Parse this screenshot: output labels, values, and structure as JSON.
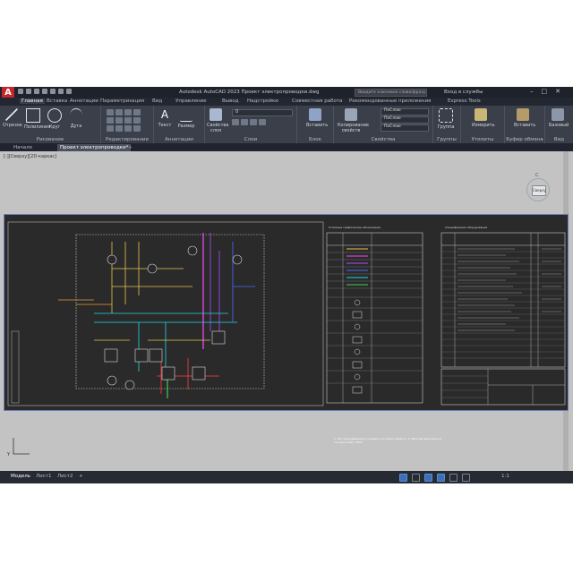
{
  "titlebar": {
    "logo": "A",
    "title": "Autodesk AutoCAD 2023   Проект электропроводки.dwg",
    "search_placeholder": "Введите ключевое слово/фразу",
    "signin": "Вход в службы",
    "minimize": "–",
    "maximize": "□",
    "close": "✕"
  },
  "ribbon_tabs": [
    "Главная",
    "Вставка",
    "Аннотации",
    "Параметризация",
    "Вид",
    "Управление",
    "Вывод",
    "Надстройки",
    "Совместная работа",
    "Рекомендованные приложения",
    "Express Tools"
  ],
  "ribbon_tab_active": "Главная",
  "tools": {
    "line": "Отрезок",
    "polyline": "Полилиния",
    "circle": "Круг",
    "arc": "Дуга",
    "text": "Текст",
    "dimension": "Размер",
    "layer_props": "Свойства слоя",
    "insert": "Вставить",
    "match_props": "Копирование свойств",
    "group": "Группа",
    "measure": "Измерить",
    "paste": "Вставить",
    "base": "Базовый"
  },
  "panels": {
    "draw": "Рисование",
    "modify": "Редактирование",
    "annotation": "Аннотации",
    "layers": "Слои",
    "block": "Блок",
    "properties": "Свойства",
    "groups": "Группы",
    "utilities": "Утилиты",
    "clipboard": "Буфер обмена",
    "view": "Вид"
  },
  "layer_combo": "0",
  "prop_combo_1": "ПоСлою",
  "prop_combo_2": "ПоСлою",
  "prop_combo_3": "ПоСлою",
  "doc_tabs": [
    "Начало",
    "Проект электропроводки*"
  ],
  "viewport_label": "[-][Сверху][2D-каркас]",
  "viewcube_label": "Сверху",
  "viewcube_compass": "С",
  "ucs": "Y",
  "layout_tabs": [
    "Модель",
    "Лист1",
    "Лист2"
  ],
  "layout_add": "+",
  "scale": "1:1",
  "legend_title": "Условные графические обозначения",
  "spec_title": "Спецификация оборудования",
  "notes": "1. Все оборудование установить согласно проекту.\n2. Монтаж выполнить в соответствии с ПУЭ.",
  "colors": {
    "accent": "#3d6fb5",
    "autocad_red": "#c8242b",
    "ui_dark": "#2b2f38",
    "drawing_bg": "#2a2a2a"
  }
}
